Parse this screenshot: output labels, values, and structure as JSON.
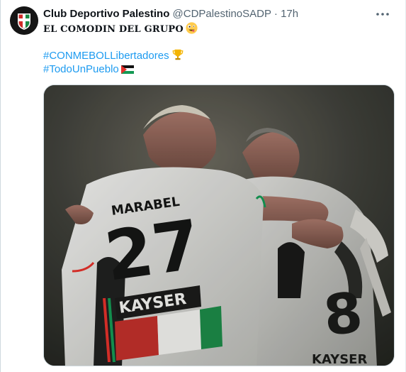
{
  "tweet": {
    "author_name": "Club Deportivo Palestino",
    "author_handle": "@CDPalestinoSADP",
    "separator": "·",
    "time": "17h",
    "text_line": "EL COMODIN DEL GRUPO",
    "hashtags": [
      "#CONMEBOLLibertadores",
      "#TodoUnPueblo"
    ],
    "media": {
      "jersey_name": "MARABEL",
      "jersey_number": "27",
      "sponsor": "KAYSER",
      "back_number": "8",
      "back_sponsor": "KAYSER"
    }
  },
  "colors": {
    "link": "#1d9bf0",
    "secondary_text": "#536471",
    "primary_text": "#0f1419",
    "flag_red": "#e4312b",
    "flag_green": "#149954"
  },
  "icons": {
    "more": "more-horizontal-icon",
    "face_emoji": "zany-face-emoji",
    "trophy": "trophy-emoji",
    "flag": "palestine-flag-emoji"
  }
}
